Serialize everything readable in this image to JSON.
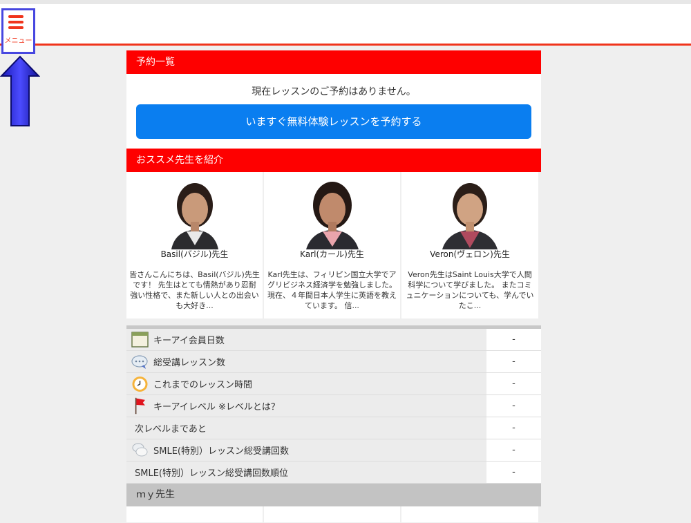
{
  "menu": {
    "label": "メニュー"
  },
  "reservations": {
    "heading": "予約一覧",
    "message": "現在レッスンのご予約はありません。",
    "cta_label": "いますぐ無料体験レッスンを予約する"
  },
  "recommended": {
    "heading": "おススメ先生を紹介",
    "teachers": [
      {
        "name": "Basil(バジル)先生",
        "desc": "皆さんこんにちは、Basil(バジル)先生です！ 先生はとても情熱があり忍耐強い性格で、また新しい人との出会いも大好き..."
      },
      {
        "name": "Karl(カール)先生",
        "desc": "Karl先生は、フィリピン国立大学でアグリビジネス経済学を勉強しました。現在、４年間日本人学生に英語を教えています。 信..."
      },
      {
        "name": "Veron(ヴェロン)先生",
        "desc": "Veron先生はSaint Louis大学で人間科学について学びました。 またコミュニケーションについても、学んでいたこ..."
      }
    ]
  },
  "stats": [
    {
      "label": "キーアイ会員日数",
      "value": "-",
      "icon": "calendar-icon"
    },
    {
      "label": "総受講レッスン数",
      "value": "-",
      "icon": "chat-bubble-icon"
    },
    {
      "label": "これまでのレッスン時間",
      "value": "-",
      "icon": "clock-icon"
    },
    {
      "label": "キーアイレベル ※レベルとは？",
      "value": "-",
      "icon": "flag-icon"
    },
    {
      "label": "次レベルまであと",
      "value": "-",
      "icon": ""
    },
    {
      "label": "SMLE(特別）レッスン総受講回数",
      "value": "-",
      "icon": "chat-bubbles-icon"
    },
    {
      "label": "SMLE(特別）レッスン総受講回数順位",
      "value": "-",
      "icon": ""
    }
  ],
  "my_teachers": {
    "heading": "ｍｙ先生"
  },
  "colors": {
    "accent_red": "#fe0000",
    "header_line": "#f0341c",
    "cta_blue": "#0a7ef0",
    "highlight_border": "#4747e0"
  }
}
